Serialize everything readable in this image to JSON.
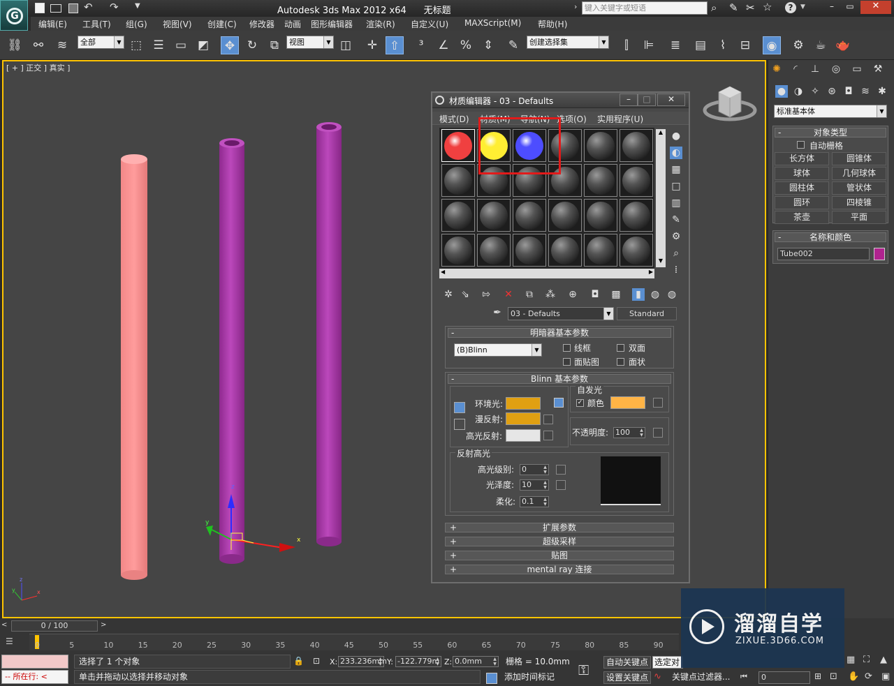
{
  "app": {
    "title": "Autodesk 3ds Max  2012 x64",
    "doc": "无标题",
    "search_placeholder": "键入关键字或短语"
  },
  "menu": [
    "编辑(E)",
    "工具(T)",
    "组(G)",
    "视图(V)",
    "创建(C)",
    "修改器",
    "动画",
    "图形编辑器",
    "渲染(R)",
    "自定义(U)",
    "MAXScript(M)",
    "帮助(H)"
  ],
  "toolbar": {
    "filter": "全部",
    "view": "视图",
    "selset": "创建选择集"
  },
  "viewport": {
    "label": "[ + ] 正交 ] 真实 ]",
    "axis_x": "x",
    "axis_y": "y",
    "axis_z": "z"
  },
  "medit": {
    "title": "材质编辑器 - 03 - Defaults",
    "menu": [
      "模式(D)",
      "材质(M)",
      "导航(N)",
      "选项(O)",
      "实用程序(U)"
    ],
    "slot_colors": [
      "#f04040",
      "#ffee33",
      "#4d4dff"
    ],
    "material_name": "03 - Defaults",
    "material_type": "Standard",
    "shader_rollout": "明暗器基本参数",
    "shader": "(B)Blinn",
    "opt_wire": "线框",
    "opt_2side": "双面",
    "opt_facemap": "面贴图",
    "opt_faceted": "面状",
    "blinn_rollout": "Blinn 基本参数",
    "selfillum": "自发光",
    "selfillum_color": "颜色",
    "ambient": "环境光:",
    "diffuse": "漫反射:",
    "specular": "高光反射:",
    "ambient_color": "#e0a012",
    "diffuse_color": "#e0a012",
    "specular_color": "#e6e6e6",
    "selfillum_swatch": "#ffb446",
    "opacity_label": "不透明度:",
    "opacity": "100",
    "spec_hl": "反射高光",
    "spec_level_label": "高光级别:",
    "spec_level": "0",
    "gloss_label": "光泽度:",
    "gloss": "10",
    "soften_label": "柔化:",
    "soften": "0.1",
    "rollouts": [
      "扩展参数",
      "超级采样",
      "贴图",
      "mental ray 连接"
    ]
  },
  "cmd": {
    "category": "标准基本体",
    "objtype_header": "对象类型",
    "autogrid": "自动栅格",
    "buttons": [
      "长方体",
      "圆锥体",
      "球体",
      "几何球体",
      "圆柱体",
      "管状体",
      "圆环",
      "四棱锥",
      "茶壶",
      "平面"
    ],
    "namecolor_header": "名称和颜色",
    "name": "Tube002",
    "obj_color": "#b0238f"
  },
  "timeline": {
    "frame": "0 / 100",
    "ticks": [
      "0",
      "5",
      "10",
      "15",
      "20",
      "25",
      "30",
      "35",
      "40",
      "45",
      "50",
      "55",
      "60",
      "65",
      "70",
      "75",
      "80",
      "85",
      "90"
    ]
  },
  "status": {
    "selected": "选择了 1 个对象",
    "prompt": "单击并拖动以选择并移动对象",
    "running": "所在行:",
    "x": "233.236mm",
    "y": "-122.779m",
    "z": "0.0mm",
    "grid": "栅格 = 10.0mm",
    "add_time_tag": "添加时间标记",
    "autokey": "自动关键点",
    "setkey": "设置关键点",
    "selected_dd": "选定对",
    "key_filter": "关键点过滤器...",
    "frame_field": "0"
  },
  "watermark": {
    "name": "溜溜自学",
    "url": "ZIXUE.3D66.COM"
  }
}
